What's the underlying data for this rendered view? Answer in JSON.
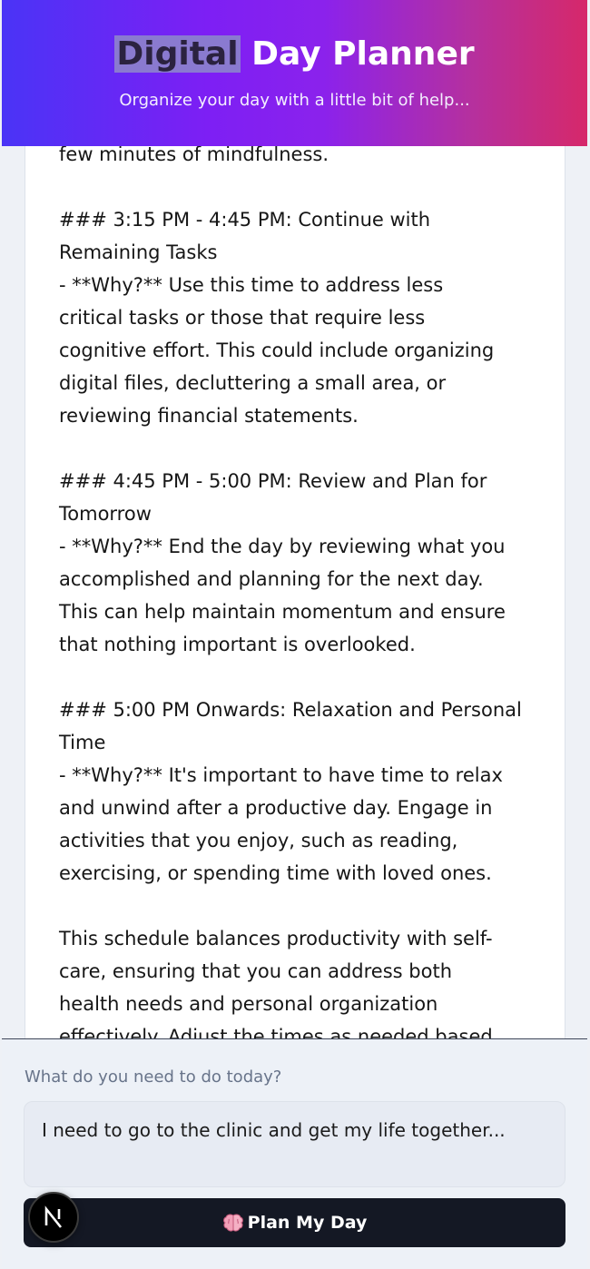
{
  "header": {
    "title_highlight": "Digital",
    "title_rest": " Day Planner",
    "subtitle": "Organize your day with a little bit of help..."
  },
  "plan": {
    "lines": [
      "few minutes of mindfulness.",
      "",
      "### 3:15 PM - 4:45 PM: Continue with",
      "Remaining Tasks",
      "- **Why?** Use this time to address less",
      "critical tasks or those that require less",
      "cognitive effort. This could include organizing",
      "digital files, decluttering a small area, or",
      "reviewing financial statements.",
      "",
      "### 4:45 PM - 5:00 PM: Review and Plan for",
      "Tomorrow",
      "- **Why?** End the day by reviewing what you",
      "accomplished and planning for the next day.",
      "This can help maintain momentum and ensure",
      "that nothing important is overlooked.",
      "",
      "### 5:00 PM Onwards: Relaxation and Personal",
      "Time",
      "- **Why?** It's important to have time to relax",
      "and unwind after a productive day. Engage in",
      "activities that you enjoy, such as reading,",
      "exercising, or spending time with loved ones.",
      "",
      "This schedule balances productivity with self-",
      "care, ensuring that you can address both",
      "health needs and personal organization",
      "effectively. Adjust the times as needed based"
    ]
  },
  "form": {
    "label": "What do you need to do today?",
    "value": "I need to go to the clinic and get my life together...",
    "button_label": "Plan My Day",
    "button_icon": "brain-icon"
  },
  "badge": {
    "letter": "N",
    "icon": "nextjs-logo-icon"
  },
  "colors": {
    "header_gradient_start": "#4a34f6",
    "header_gradient_end": "#d6286a",
    "button_bg": "#141824",
    "page_bg": "#eef1f6"
  }
}
